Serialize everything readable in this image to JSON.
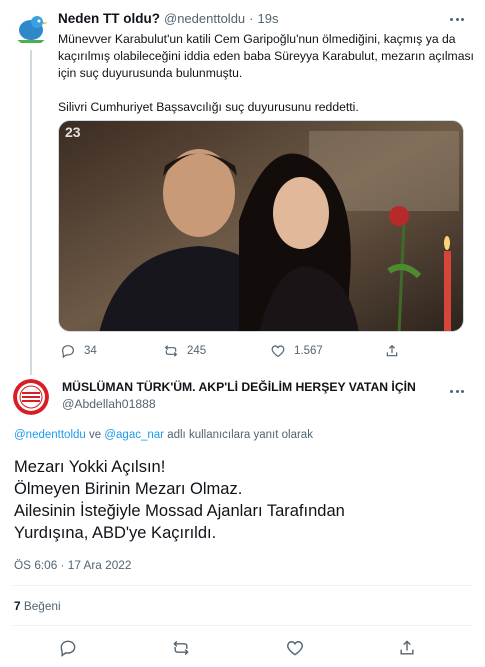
{
  "tweet1": {
    "display_name": "Neden TT oldu?",
    "handle": "@nedenttoldu",
    "separator": "·",
    "time": "19s",
    "line1": "Münevver Karabulut'un katili Cem Garipoğlu'nun ölmediğini, kaçmış ya da",
    "line2": "kaçırılmış olabileceğini iddia eden baba Süreyya Karabulut, mezarın açılması",
    "line3": "için suç duyurusunda bulunmuştu.",
    "line4": "Silivri Cumhuriyet Başsavcılığı suç duyurusunu reddetti.",
    "image_watermark": "23",
    "replies": "34",
    "retweets": "245",
    "likes": "1.567"
  },
  "tweet2": {
    "display_name": "MÜSLÜMAN TÜRK'ÜM. AKP'Lİ DEĞİLİM HERŞEY VATAN İÇİN",
    "handle": "@Abdellah01888",
    "reply_to_user1": "@nedenttoldu",
    "reply_to_and": "ve",
    "reply_to_user2": "@agac_nar",
    "reply_to_suffix": "adlı kullanıcılara yanıt olarak",
    "body_line1": "Mezarı Yokki Açılsın!",
    "body_line2": "Ölmeyen Birinin Mezarı Olmaz.",
    "body_line3": "Ailesinin İsteğiyle Mossad Ajanları Tarafından",
    "body_line4": "Yurdışına, ABD'ye Kaçırıldı.",
    "timestamp": "ÖS 6:06 · 17 Ara 2022",
    "like_count": "7",
    "like_label": "Beğeni"
  },
  "colors": {
    "accent": "#1d9bf0",
    "text": "#0f1419",
    "muted": "#536471",
    "divider": "#eff3f4"
  }
}
